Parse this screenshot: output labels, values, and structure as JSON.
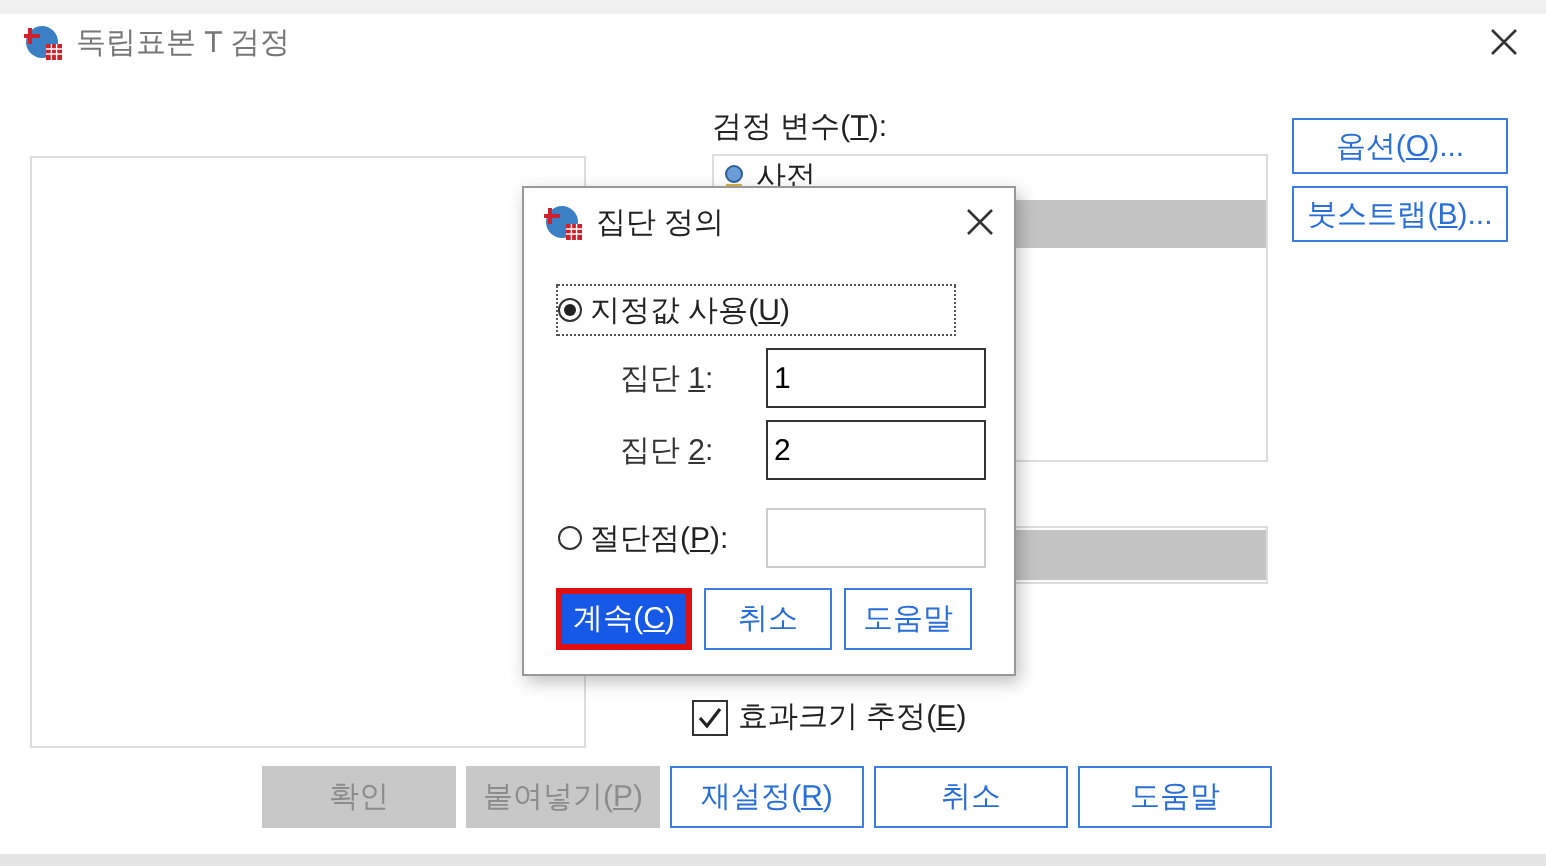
{
  "window": {
    "title": "독립표본 T 검정"
  },
  "test_variables": {
    "label": {
      "text": "검정 변수(",
      "key": "T",
      "after": "):"
    },
    "items": [
      {
        "name": "사전",
        "selected": false
      },
      {
        "selected": true
      }
    ]
  },
  "grouping_variable": {
    "selected": true
  },
  "side_buttons": [
    {
      "label": {
        "text": "옵션(",
        "key": "O",
        "after": ")..."
      }
    },
    {
      "label": {
        "text": "붓스트랩(",
        "key": "B",
        "after": ")..."
      }
    }
  ],
  "effect_size": {
    "label": {
      "text": "효과크기 추정(",
      "key": "E",
      "after": ")"
    },
    "checked": true
  },
  "buttons": [
    {
      "label": {
        "text": "확인"
      },
      "disabled": true
    },
    {
      "label": {
        "text": "붙여넣기(",
        "key": "P",
        "after": ")"
      },
      "disabled": true
    },
    {
      "label": {
        "text": "재설정(",
        "key": "R",
        "after": ")"
      },
      "disabled": false
    },
    {
      "label": {
        "text": "취소"
      },
      "disabled": false
    },
    {
      "label": {
        "text": "도움말"
      },
      "disabled": false
    }
  ],
  "dialog": {
    "title": "집단 정의",
    "options": [
      {
        "kind": "values",
        "label": {
          "text": "지정값 사용(",
          "key": "U",
          "after": ")"
        },
        "selected": true,
        "fields": [
          {
            "label": {
              "text": "집단 ",
              "key": "1",
              "after": ":"
            },
            "value": "1"
          },
          {
            "label": {
              "text": "집단 ",
              "key": "2",
              "after": ":"
            },
            "value": "2"
          }
        ]
      },
      {
        "kind": "cutpoint",
        "label": {
          "text": "절단점(",
          "key": "P",
          "after": "):"
        },
        "selected": false
      }
    ],
    "buttons": [
      {
        "label": {
          "text": "계속(",
          "key": "C",
          "after": ")"
        },
        "default": true
      },
      {
        "label": {
          "text": "취소"
        },
        "default": false
      },
      {
        "label": {
          "text": "도움말"
        },
        "default": false
      }
    ]
  }
}
